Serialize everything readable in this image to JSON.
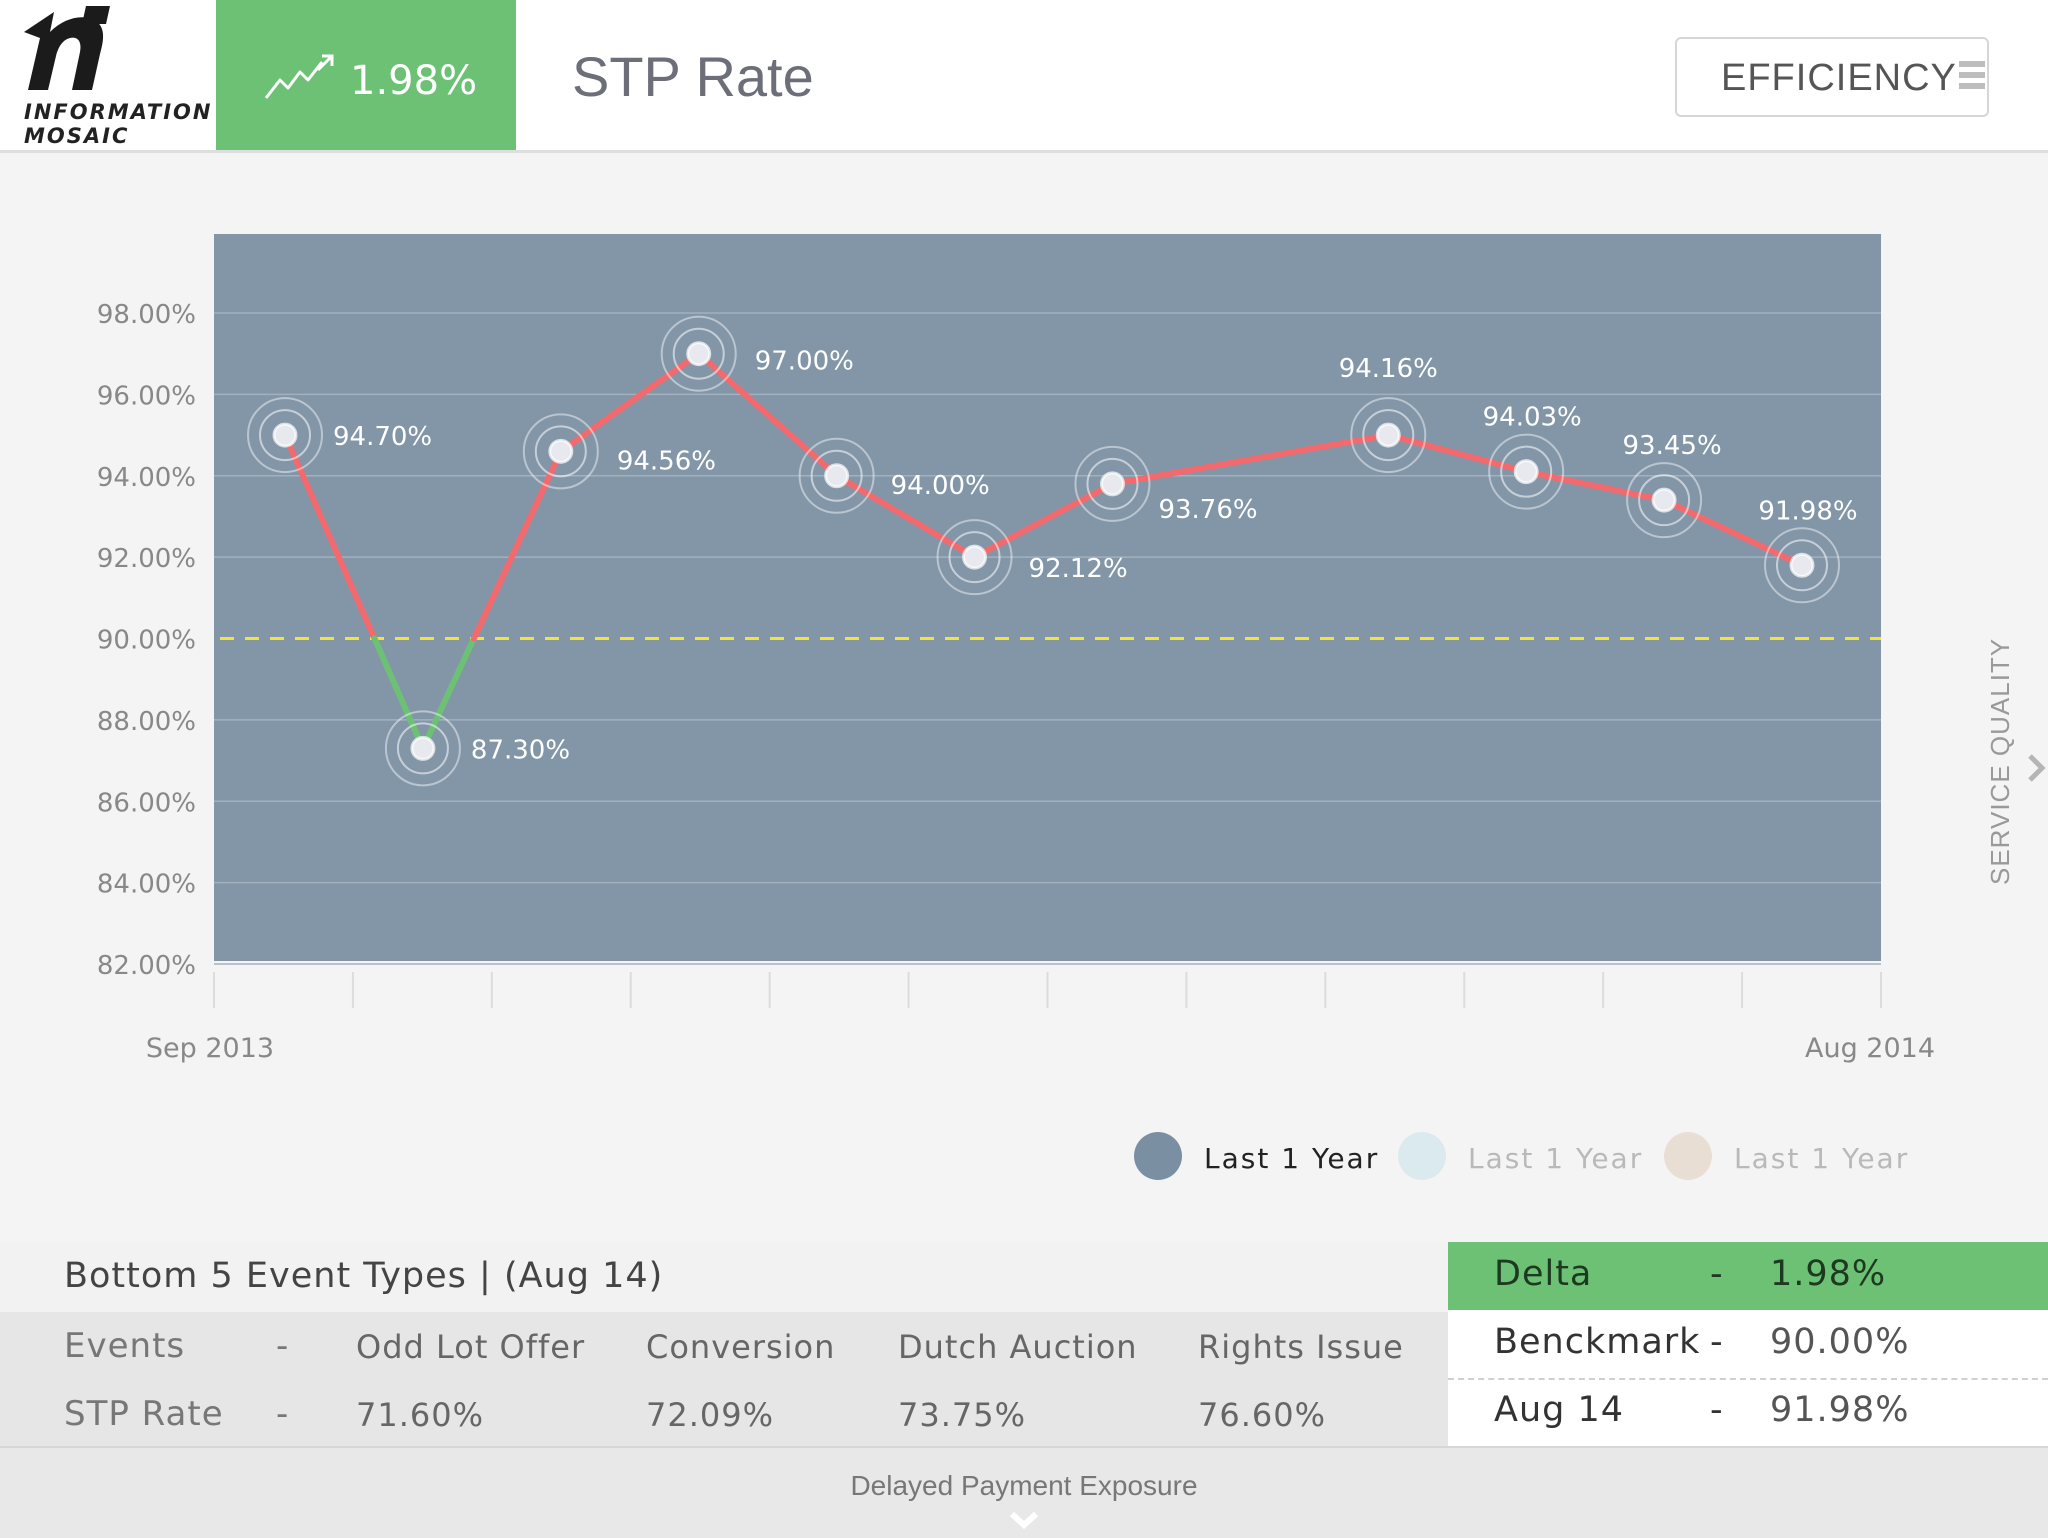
{
  "brand": {
    "line1": "INFORMATION",
    "line2": "MOSAIC"
  },
  "kpi": {
    "value": "1.98%",
    "icon": "trend-up-icon",
    "color": "#6cc174"
  },
  "page_title": "STP Rate",
  "efficiency_button": {
    "label": "EFFICIENCY",
    "icon": "menu-icon"
  },
  "side_nav": {
    "label": "SERVICE QUALITY",
    "icon": "chevron-right-icon"
  },
  "chart_data": {
    "type": "line",
    "title": "",
    "xlabel": "",
    "ylabel": "",
    "ylim": [
      82,
      98
    ],
    "y_ticks": [
      "82.00%",
      "84.00%",
      "86.00%",
      "88.00%",
      "90.00%",
      "92.00%",
      "94.00%",
      "96.00%",
      "98.00%"
    ],
    "x_tick_labels": {
      "first": "Sep 2013",
      "last": "Aug 2014"
    },
    "benchmark": 90,
    "series": [
      {
        "name": "Last 1 Year",
        "values": [
          95.0,
          87.3,
          94.6,
          97.0,
          94.0,
          92.0,
          93.8,
          null,
          95.0,
          94.1,
          93.4,
          91.8
        ],
        "labels": [
          "94.70%",
          "87.30%",
          "94.56%",
          "97.00%",
          "94.00%",
          "92.12%",
          "93.76%",
          "",
          "94.16%",
          "94.03%",
          "93.45%",
          "91.98%"
        ]
      }
    ],
    "grid": true,
    "colors": {
      "plot_bg": "#8296a8",
      "above": "#f26a6e",
      "below": "#6cc174",
      "benchmark": "#f2e438"
    }
  },
  "legend": [
    {
      "label": "Last 1 Year",
      "color": "#7b8fa2",
      "text_color": "#222222"
    },
    {
      "label": "Last 1 Year",
      "color": "#dbeaef",
      "text_color": "#b9b9b9"
    },
    {
      "label": "Last 1 Year",
      "color": "#e9ded4",
      "text_color": "#b9b9b9"
    }
  ],
  "bottom5": {
    "title": "Bottom 5 Event Types | (Aug 14)",
    "events_label": "Events",
    "stp_label": "STP Rate",
    "dash": "-",
    "events": [
      "Odd Lot Offer",
      "Conversion",
      "Dutch Auction",
      "Rights Issue"
    ],
    "rates": [
      "71.60%",
      "72.09%",
      "73.75%",
      "76.60%"
    ]
  },
  "summary": {
    "delta": {
      "label": "Delta",
      "dash": "-",
      "value": "1.98%"
    },
    "benchmark": {
      "label": "Benckmark",
      "dash": "-",
      "value": "90.00%"
    },
    "current": {
      "label": "Aug 14",
      "dash": "-",
      "value": "91.98%"
    }
  },
  "footer": {
    "label": "Delayed Payment Exposure",
    "icon": "chevron-down-icon"
  }
}
